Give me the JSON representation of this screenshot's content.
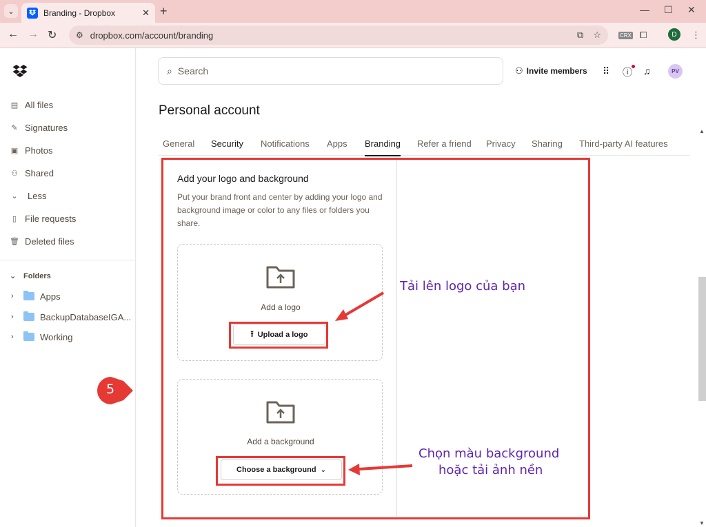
{
  "browser": {
    "tab_title": "Branding - Dropbox",
    "url": "dropbox.com/account/branding",
    "profile_initial": "D",
    "ext_label": "CRX"
  },
  "sidebar": {
    "items": [
      {
        "label": "All files",
        "icon": "all-files-icon"
      },
      {
        "label": "Signatures",
        "icon": "signature-icon"
      },
      {
        "label": "Photos",
        "icon": "photo-icon"
      },
      {
        "label": "Shared",
        "icon": "shared-icon"
      },
      {
        "label": "Less",
        "icon": "chevron-down-icon"
      },
      {
        "label": "File requests",
        "icon": "file-request-icon"
      },
      {
        "label": "Deleted files",
        "icon": "trash-icon"
      }
    ],
    "folders_heading": "Folders",
    "folders": [
      "Apps",
      "BackupDatabaseIGA...",
      "Working"
    ]
  },
  "header": {
    "search_placeholder": "Search",
    "invite_label": "Invite members",
    "avatar_initials": "PV"
  },
  "page": {
    "title": "Personal account",
    "tabs": [
      "General",
      "Security",
      "Notifications",
      "Apps",
      "Branding",
      "Refer a friend",
      "Privacy",
      "Sharing",
      "Third-party AI features"
    ],
    "active_tab": "Branding"
  },
  "branding": {
    "title": "Add your logo and background",
    "description": "Put your brand front and center by adding your logo and background image or color to any files or folders you share.",
    "logo_label": "Add a logo",
    "logo_button": "Upload a logo",
    "bg_label": "Add a background",
    "bg_button": "Choose a background"
  },
  "annotations": {
    "step": "5",
    "logo_note": "Tải lên logo của bạn",
    "bg_note_line1": "Chọn màu background",
    "bg_note_line2": "hoặc tải ảnh nền",
    "color": "#e53935",
    "text_color": "#5e24b0"
  },
  "colors": {
    "dropbox_blue": "#0061fe",
    "tabstrip": "#f3cccc"
  }
}
